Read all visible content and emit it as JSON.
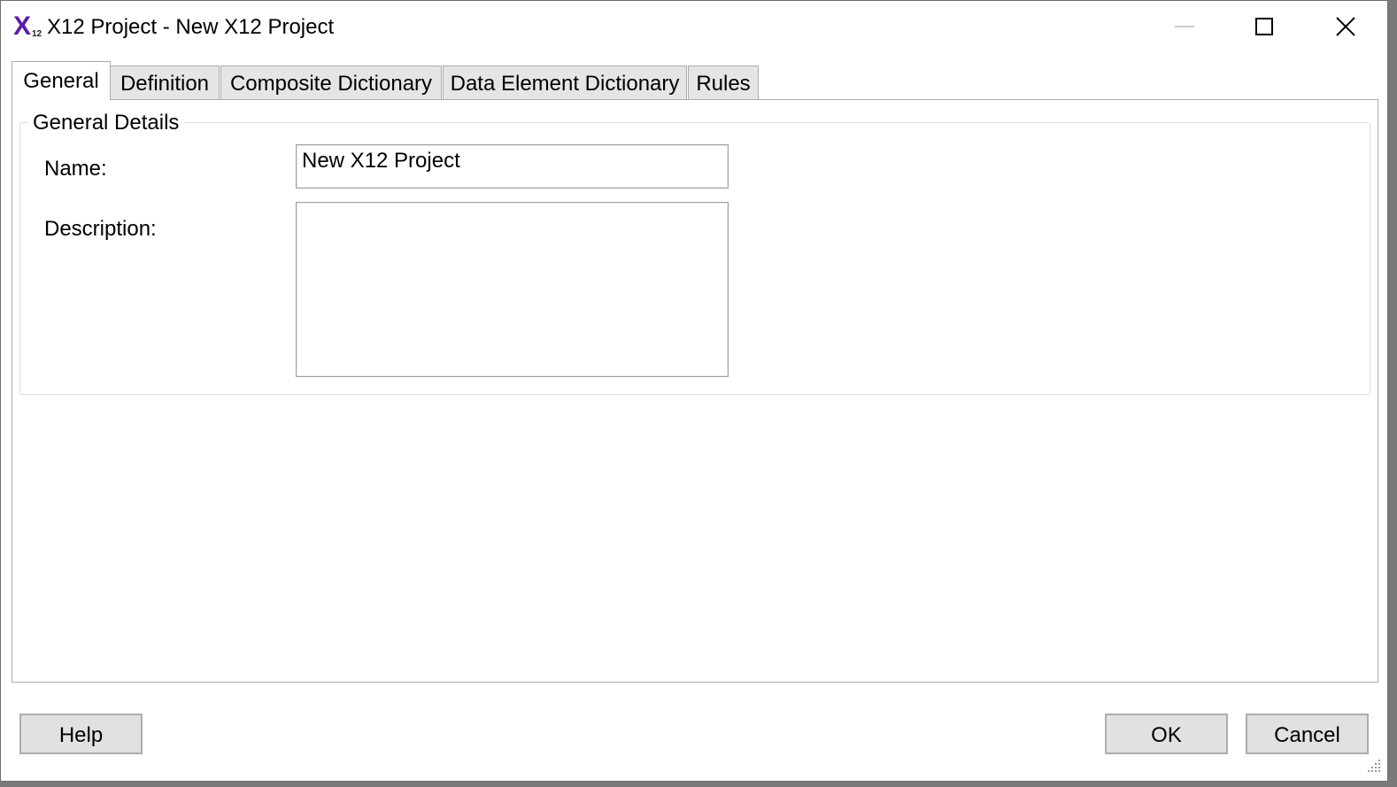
{
  "window": {
    "title": "X12 Project - New X12 Project",
    "icon": {
      "name": "x12-app-icon",
      "letter": "X",
      "subscript": "12",
      "color": "#5b1aa8"
    }
  },
  "title_controls": {
    "minimize_icon": "minimize-icon",
    "maximize_icon": "maximize-icon",
    "close_icon": "close-icon"
  },
  "tabs": [
    {
      "label": "General",
      "active": true
    },
    {
      "label": "Definition",
      "active": false
    },
    {
      "label": "Composite Dictionary",
      "active": false
    },
    {
      "label": "Data Element Dictionary",
      "active": false
    },
    {
      "label": "Rules",
      "active": false
    }
  ],
  "general": {
    "group_title": "General Details",
    "name_label": "Name:",
    "name_value": "New X12 Project",
    "description_label": "Description:",
    "description_value": ""
  },
  "buttons": {
    "help": "Help",
    "ok": "OK",
    "cancel": "Cancel"
  },
  "colors": {
    "accent": "#5b1aa8",
    "button_face": "#e1e1e1",
    "tab_inactive": "#e5e5e5"
  }
}
